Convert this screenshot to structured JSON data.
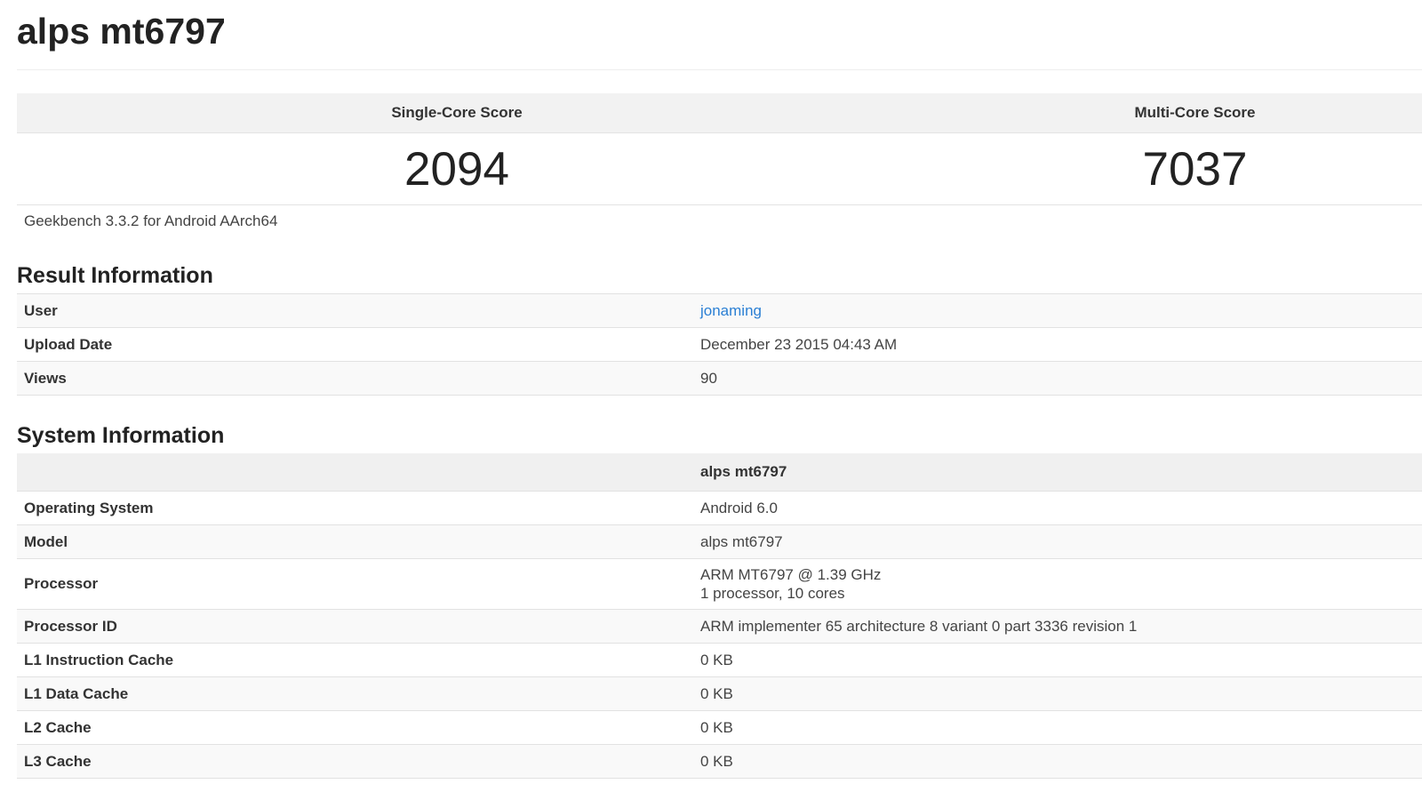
{
  "page": {
    "title": "alps mt6797",
    "version": "Geekbench 3.3.2 for Android AArch64"
  },
  "scores": {
    "single_label": "Single-Core Score",
    "single_value": "2094",
    "multi_label": "Multi-Core Score",
    "multi_value": "7037"
  },
  "result_info": {
    "title": "Result Information",
    "rows": [
      {
        "key": "User",
        "value": "jonaming"
      },
      {
        "key": "Upload Date",
        "value": "December 23 2015 04:43 AM"
      },
      {
        "key": "Views",
        "value": "90"
      }
    ]
  },
  "system_info": {
    "title": "System Information",
    "header": "alps mt6797",
    "rows": [
      {
        "key": "Operating System",
        "value": "Android 6.0"
      },
      {
        "key": "Model",
        "value": "alps mt6797"
      },
      {
        "key": "Processor",
        "value": "ARM MT6797 @ 1.39 GHz",
        "value2": "1 processor, 10 cores"
      },
      {
        "key": "Processor ID",
        "value": "ARM implementer 65 architecture 8 variant 0 part 3336 revision 1"
      },
      {
        "key": "L1 Instruction Cache",
        "value": "0 KB"
      },
      {
        "key": "L1 Data Cache",
        "value": "0 KB"
      },
      {
        "key": "L2 Cache",
        "value": "0 KB"
      },
      {
        "key": "L3 Cache",
        "value": "0 KB"
      }
    ]
  },
  "colors": {
    "link": "#2a7fd4",
    "header_bg": "#f2f2f2"
  }
}
